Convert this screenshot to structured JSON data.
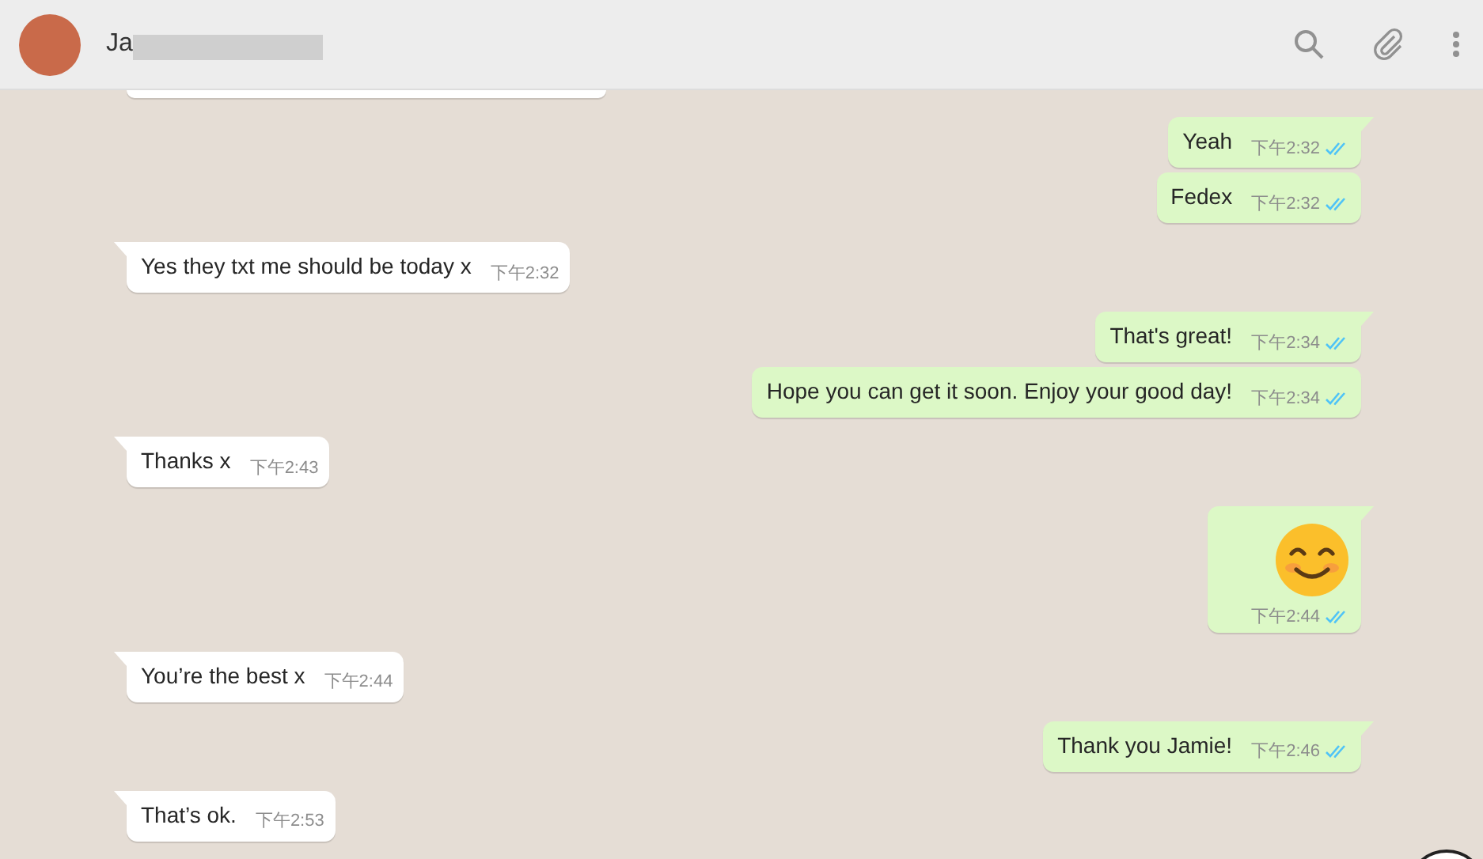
{
  "header": {
    "contact_name": "Ja"
  },
  "messages": [
    {
      "kind": "text",
      "outgoing": true,
      "tail": true,
      "text": "Yeah",
      "time": "下午2:32",
      "read": true
    },
    {
      "kind": "text",
      "outgoing": true,
      "tail": false,
      "text": "Fedex",
      "time": "下午2:32",
      "read": true
    },
    {
      "kind": "text",
      "outgoing": false,
      "tail": true,
      "text": "Yes they txt me should be today x",
      "time": "下午2:32"
    },
    {
      "kind": "text",
      "outgoing": true,
      "tail": true,
      "text": "That's great!",
      "time": "下午2:34",
      "read": true
    },
    {
      "kind": "text",
      "outgoing": true,
      "tail": false,
      "text": "Hope you can get it soon. Enjoy your good day!",
      "time": "下午2:34",
      "read": true
    },
    {
      "kind": "text",
      "outgoing": false,
      "tail": true,
      "text": "Thanks x",
      "time": "下午2:43"
    },
    {
      "kind": "emoji",
      "outgoing": true,
      "tail": true,
      "time": "下午2:44",
      "read": true
    },
    {
      "kind": "text",
      "outgoing": false,
      "tail": true,
      "text": "You’re the best x",
      "time": "下午2:44"
    },
    {
      "kind": "text",
      "outgoing": true,
      "tail": true,
      "text": "Thank you Jamie!",
      "time": "下午2:46",
      "read": true
    },
    {
      "kind": "text",
      "outgoing": false,
      "tail": true,
      "text": "That’s ok.",
      "time": "下午2:53"
    }
  ]
}
